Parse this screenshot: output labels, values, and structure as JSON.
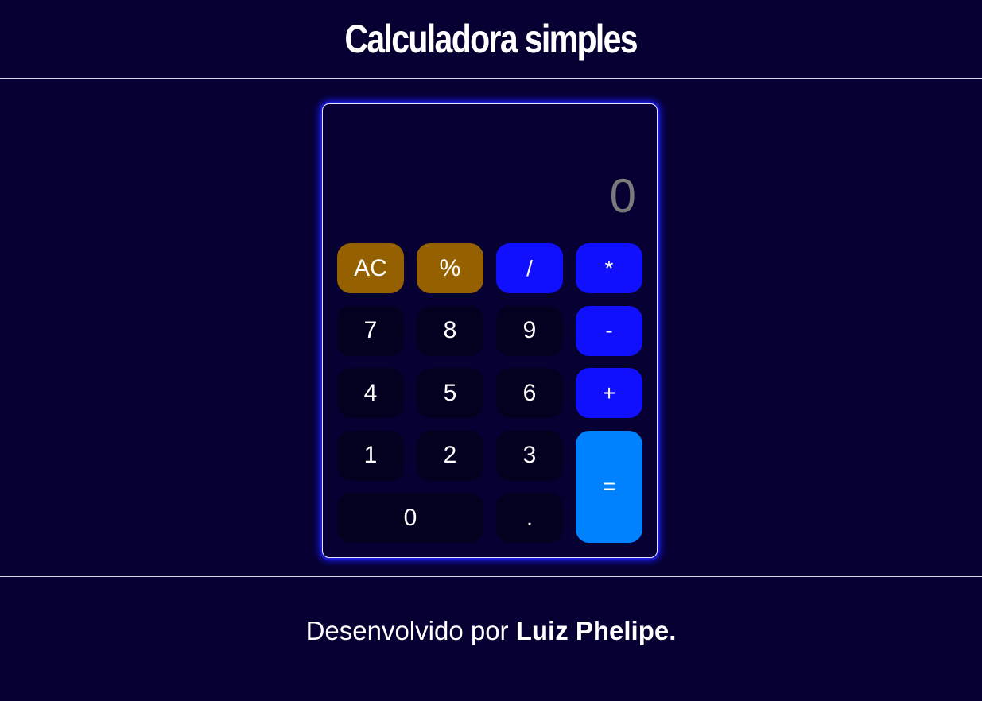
{
  "header": {
    "title": "Calculadora simples"
  },
  "display": {
    "value": "0"
  },
  "keys": [
    {
      "label": "AC",
      "type": "func"
    },
    {
      "label": "%",
      "type": "func"
    },
    {
      "label": "/",
      "type": "op"
    },
    {
      "label": "*",
      "type": "op"
    },
    {
      "label": "7",
      "type": "num"
    },
    {
      "label": "8",
      "type": "num"
    },
    {
      "label": "9",
      "type": "num"
    },
    {
      "label": "-",
      "type": "op"
    },
    {
      "label": "4",
      "type": "num"
    },
    {
      "label": "5",
      "type": "num"
    },
    {
      "label": "6",
      "type": "num"
    },
    {
      "label": "+",
      "type": "op"
    },
    {
      "label": "1",
      "type": "num"
    },
    {
      "label": "2",
      "type": "num"
    },
    {
      "label": "3",
      "type": "num"
    },
    {
      "label": "=",
      "type": "eq"
    },
    {
      "label": "0",
      "type": "num"
    },
    {
      "label": ".",
      "type": "num"
    }
  ],
  "footer": {
    "prefix": "Desenvolvido por ",
    "author": "Luiz Phelipe."
  },
  "colors": {
    "background": "#070032",
    "function_key": "#946000",
    "operator_key": "#1010ff",
    "equals_key": "#0082ff",
    "number_key": "#040020",
    "display_text": "#7a7a7a"
  }
}
